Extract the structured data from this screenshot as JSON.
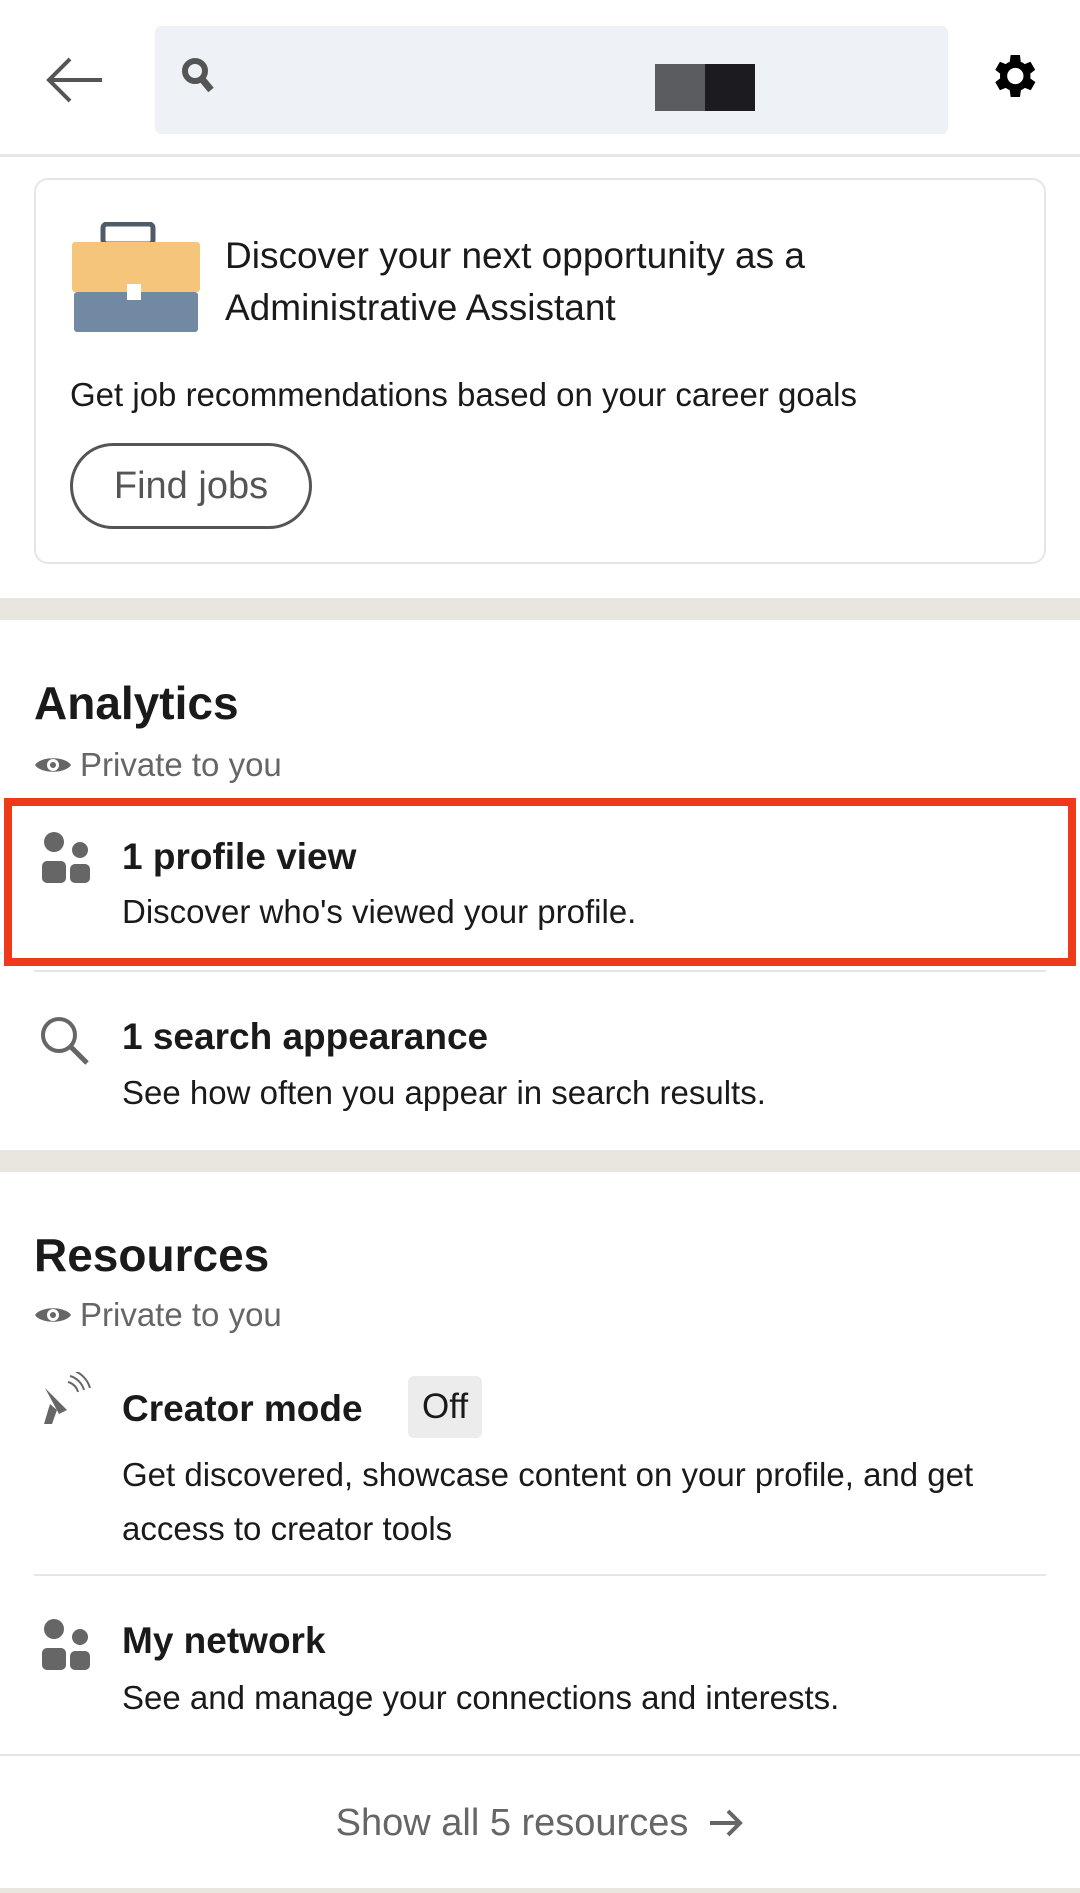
{
  "header": {
    "search_placeholder": ""
  },
  "job_card": {
    "title": "Discover your next opportunity as a Administrative Assistant",
    "subtitle": "Get job recommendations based on your career goals",
    "button": "Find jobs"
  },
  "analytics": {
    "heading": "Analytics",
    "privacy": "Private to you",
    "items": [
      {
        "title": "1 profile view",
        "subtitle": "Discover who's viewed your profile.",
        "icon": "people-icon"
      },
      {
        "title": "1 search appearance",
        "subtitle": "See how often you appear in search results.",
        "icon": "search-icon"
      }
    ]
  },
  "resources": {
    "heading": "Resources",
    "privacy": "Private to you",
    "items": [
      {
        "title": "Creator mode",
        "badge": "Off",
        "subtitle": "Get discovered, showcase content on your profile, and get access to creator tools",
        "icon": "satellite-dish-icon"
      },
      {
        "title": "My network",
        "subtitle": "See and manage your connections and interests.",
        "icon": "people-icon"
      }
    ],
    "show_all": "Show all 5 resources"
  },
  "colors": {
    "highlight": "#ee3a18",
    "band": "#e9e5df",
    "search_bg": "#eef2f6"
  }
}
